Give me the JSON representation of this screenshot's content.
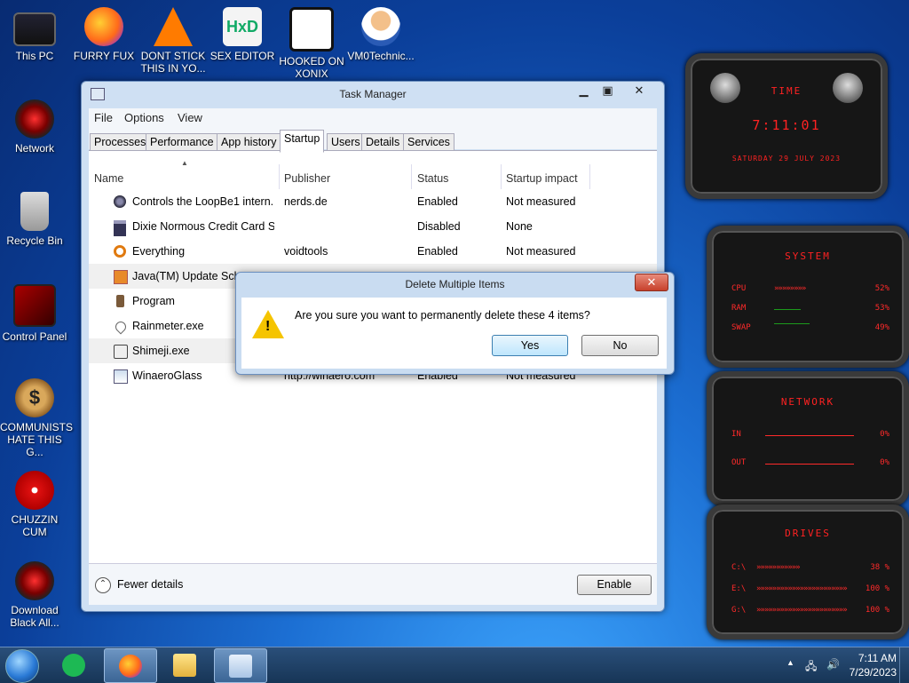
{
  "desktop": {
    "icons": [
      {
        "label": "This PC"
      },
      {
        "label": "FURRY FUX"
      },
      {
        "label": "DONT STICK THIS IN YO..."
      },
      {
        "label": "SEX EDITOR"
      },
      {
        "label": "HOOKED ON XONIX"
      },
      {
        "label": "VM0Technic..."
      },
      {
        "label": "Network"
      },
      {
        "label": "Recycle Bin"
      },
      {
        "label": "Control Panel"
      },
      {
        "label": "COMMUNISTS HATE THIS G..."
      },
      {
        "label": "CHUZZIN CUM"
      },
      {
        "label": "Download Black All..."
      }
    ],
    "hex_glyph": "HxD",
    "money_glyph": "$"
  },
  "task_manager": {
    "title": "Task Manager",
    "menu": [
      "File",
      "Options",
      "View"
    ],
    "tabs": [
      "Processes",
      "Performance",
      "App history",
      "Startup",
      "Users",
      "Details",
      "Services"
    ],
    "active_tab": "Startup",
    "columns": [
      "Name",
      "Publisher",
      "Status",
      "Startup impact"
    ],
    "rows": [
      {
        "name": "Controls the LoopBe1 intern...",
        "publisher": "nerds.de",
        "status": "Enabled",
        "impact": "Not measured"
      },
      {
        "name": "Dixie Normous Credit Card S...",
        "publisher": "",
        "status": "Disabled",
        "impact": "None"
      },
      {
        "name": "Everything",
        "publisher": "voidtools",
        "status": "Enabled",
        "impact": "Not measured"
      },
      {
        "name": "Java(TM) Update Sche",
        "publisher": "",
        "status": "",
        "impact": ""
      },
      {
        "name": "Program",
        "publisher": "",
        "status": "",
        "impact": ""
      },
      {
        "name": "Rainmeter.exe",
        "publisher": "",
        "status": "",
        "impact": ""
      },
      {
        "name": "Shimeji.exe",
        "publisher": "",
        "status": "",
        "impact": ""
      },
      {
        "name": "WinaeroGlass",
        "publisher": "http://winaero.com",
        "status": "Enabled",
        "impact": "Not measured"
      }
    ],
    "fewer_details": "Fewer details",
    "enable_button": "Enable"
  },
  "dialog": {
    "title": "Delete Multiple Items",
    "message": "Are you sure you want to permanently delete these 4 items?",
    "yes": "Yes",
    "no": "No",
    "close": "✕"
  },
  "gadgets": {
    "time": {
      "heading": "TIME",
      "clock": "7:11:01",
      "date": "SATURDAY 29 JULY 2023"
    },
    "system": {
      "heading": "SYSTEM",
      "cpu_label": "CPU",
      "cpu_value": "52%",
      "ram_label": "RAM",
      "ram_value": "53%",
      "swap_label": "SWAP",
      "swap_value": "49%"
    },
    "network": {
      "heading": "NETWORK",
      "in_label": "IN",
      "in_value": "0%",
      "out_label": "OUT",
      "out_value": "0%"
    },
    "drives": {
      "heading": "DRIVES",
      "d1_label": "C:\\",
      "d1_value": "38 %",
      "d2_label": "E:\\",
      "d2_value": "100 %",
      "d3_label": "G:\\",
      "d3_value": "100 %"
    }
  },
  "taskbar": {
    "time": "7:11 AM",
    "date": "7/29/2023",
    "tray_arrow": "▲"
  }
}
